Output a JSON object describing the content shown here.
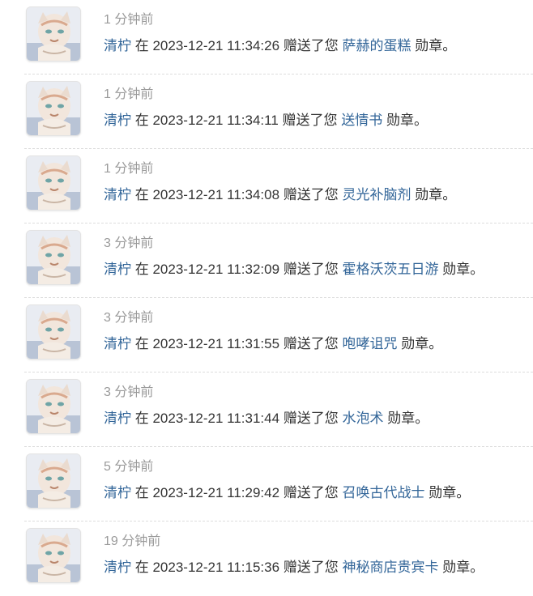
{
  "notifications": [
    {
      "ago": "1 分钟前",
      "user": "清柠",
      "in_word": "在",
      "timestamp": "2023-12-21 11:34:26",
      "gift_text": "赠送了您",
      "medal": "萨赫的蛋糕",
      "suffix": "勋章。"
    },
    {
      "ago": "1 分钟前",
      "user": "清柠",
      "in_word": "在",
      "timestamp": "2023-12-21 11:34:11",
      "gift_text": "赠送了您",
      "medal": "送情书",
      "suffix": "勋章。"
    },
    {
      "ago": "1 分钟前",
      "user": "清柠",
      "in_word": "在",
      "timestamp": "2023-12-21 11:34:08",
      "gift_text": "赠送了您",
      "medal": "灵光补脑剂",
      "suffix": "勋章。"
    },
    {
      "ago": "3 分钟前",
      "user": "清柠",
      "in_word": "在",
      "timestamp": "2023-12-21 11:32:09",
      "gift_text": "赠送了您",
      "medal": "霍格沃茨五日游",
      "suffix": "勋章。"
    },
    {
      "ago": "3 分钟前",
      "user": "清柠",
      "in_word": "在",
      "timestamp": "2023-12-21 11:31:55",
      "gift_text": "赠送了您",
      "medal": "咆哮诅咒",
      "suffix": "勋章。"
    },
    {
      "ago": "3 分钟前",
      "user": "清柠",
      "in_word": "在",
      "timestamp": "2023-12-21 11:31:44",
      "gift_text": "赠送了您",
      "medal": "水泡术",
      "suffix": "勋章。"
    },
    {
      "ago": "5 分钟前",
      "user": "清柠",
      "in_word": "在",
      "timestamp": "2023-12-21 11:29:42",
      "gift_text": "赠送了您",
      "medal": "召唤古代战士",
      "suffix": "勋章。"
    },
    {
      "ago": "19 分钟前",
      "user": "清柠",
      "in_word": "在",
      "timestamp": "2023-12-21 11:15:36",
      "gift_text": "赠送了您",
      "medal": "神秘商店贵宾卡",
      "suffix": "勋章。"
    }
  ],
  "colors": {
    "link": "#336699",
    "muted": "#9a9a9a",
    "text": "#333333"
  }
}
